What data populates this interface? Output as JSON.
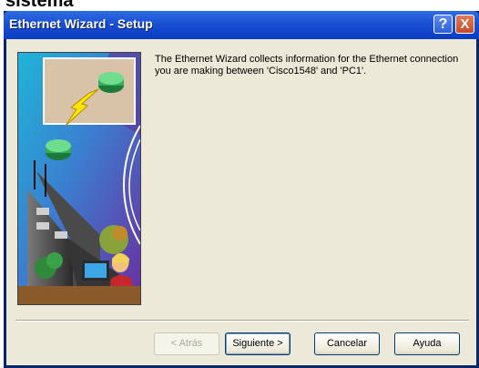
{
  "background_fragment": "sistema",
  "window": {
    "title": "Ethernet Wizard - Setup",
    "title_color": "#0b3cc4",
    "help_glyph": "?",
    "close_glyph": "X"
  },
  "body": {
    "message": "The Ethernet Wizard collects information for the Ethernet connection you are making between 'Cisco1548' and 'PC1'."
  },
  "buttons": {
    "back": "< Atrás",
    "next": "Siguiente >",
    "cancel": "Cancelar",
    "help": "Ayuda"
  },
  "illustration": {
    "icon": "network-wizard-illustration",
    "router_icon": "router-icon",
    "link_icon": "lightning-icon"
  }
}
